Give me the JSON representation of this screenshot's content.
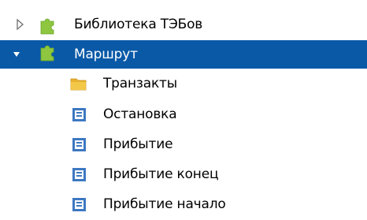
{
  "tree": {
    "library": {
      "label": "Библиотека ТЭБов",
      "icon": "puzzle-icon",
      "expanded": false
    },
    "route": {
      "label": "Маршрут",
      "icon": "puzzle-icon",
      "expanded": true,
      "selected": true,
      "children": [
        {
          "label": "Транзакты",
          "icon": "folder-icon"
        },
        {
          "label": "Остановка",
          "icon": "list-document-icon"
        },
        {
          "label": "Прибытие",
          "icon": "list-document-icon"
        },
        {
          "label": "Прибытие конец",
          "icon": "list-document-icon"
        },
        {
          "label": "Прибытие начало",
          "icon": "list-document-icon"
        }
      ]
    }
  },
  "colors": {
    "selection": "#0a59a7",
    "puzzle": "#8ec63f",
    "folder": "#e9b22f",
    "document": "#3d78c2"
  }
}
